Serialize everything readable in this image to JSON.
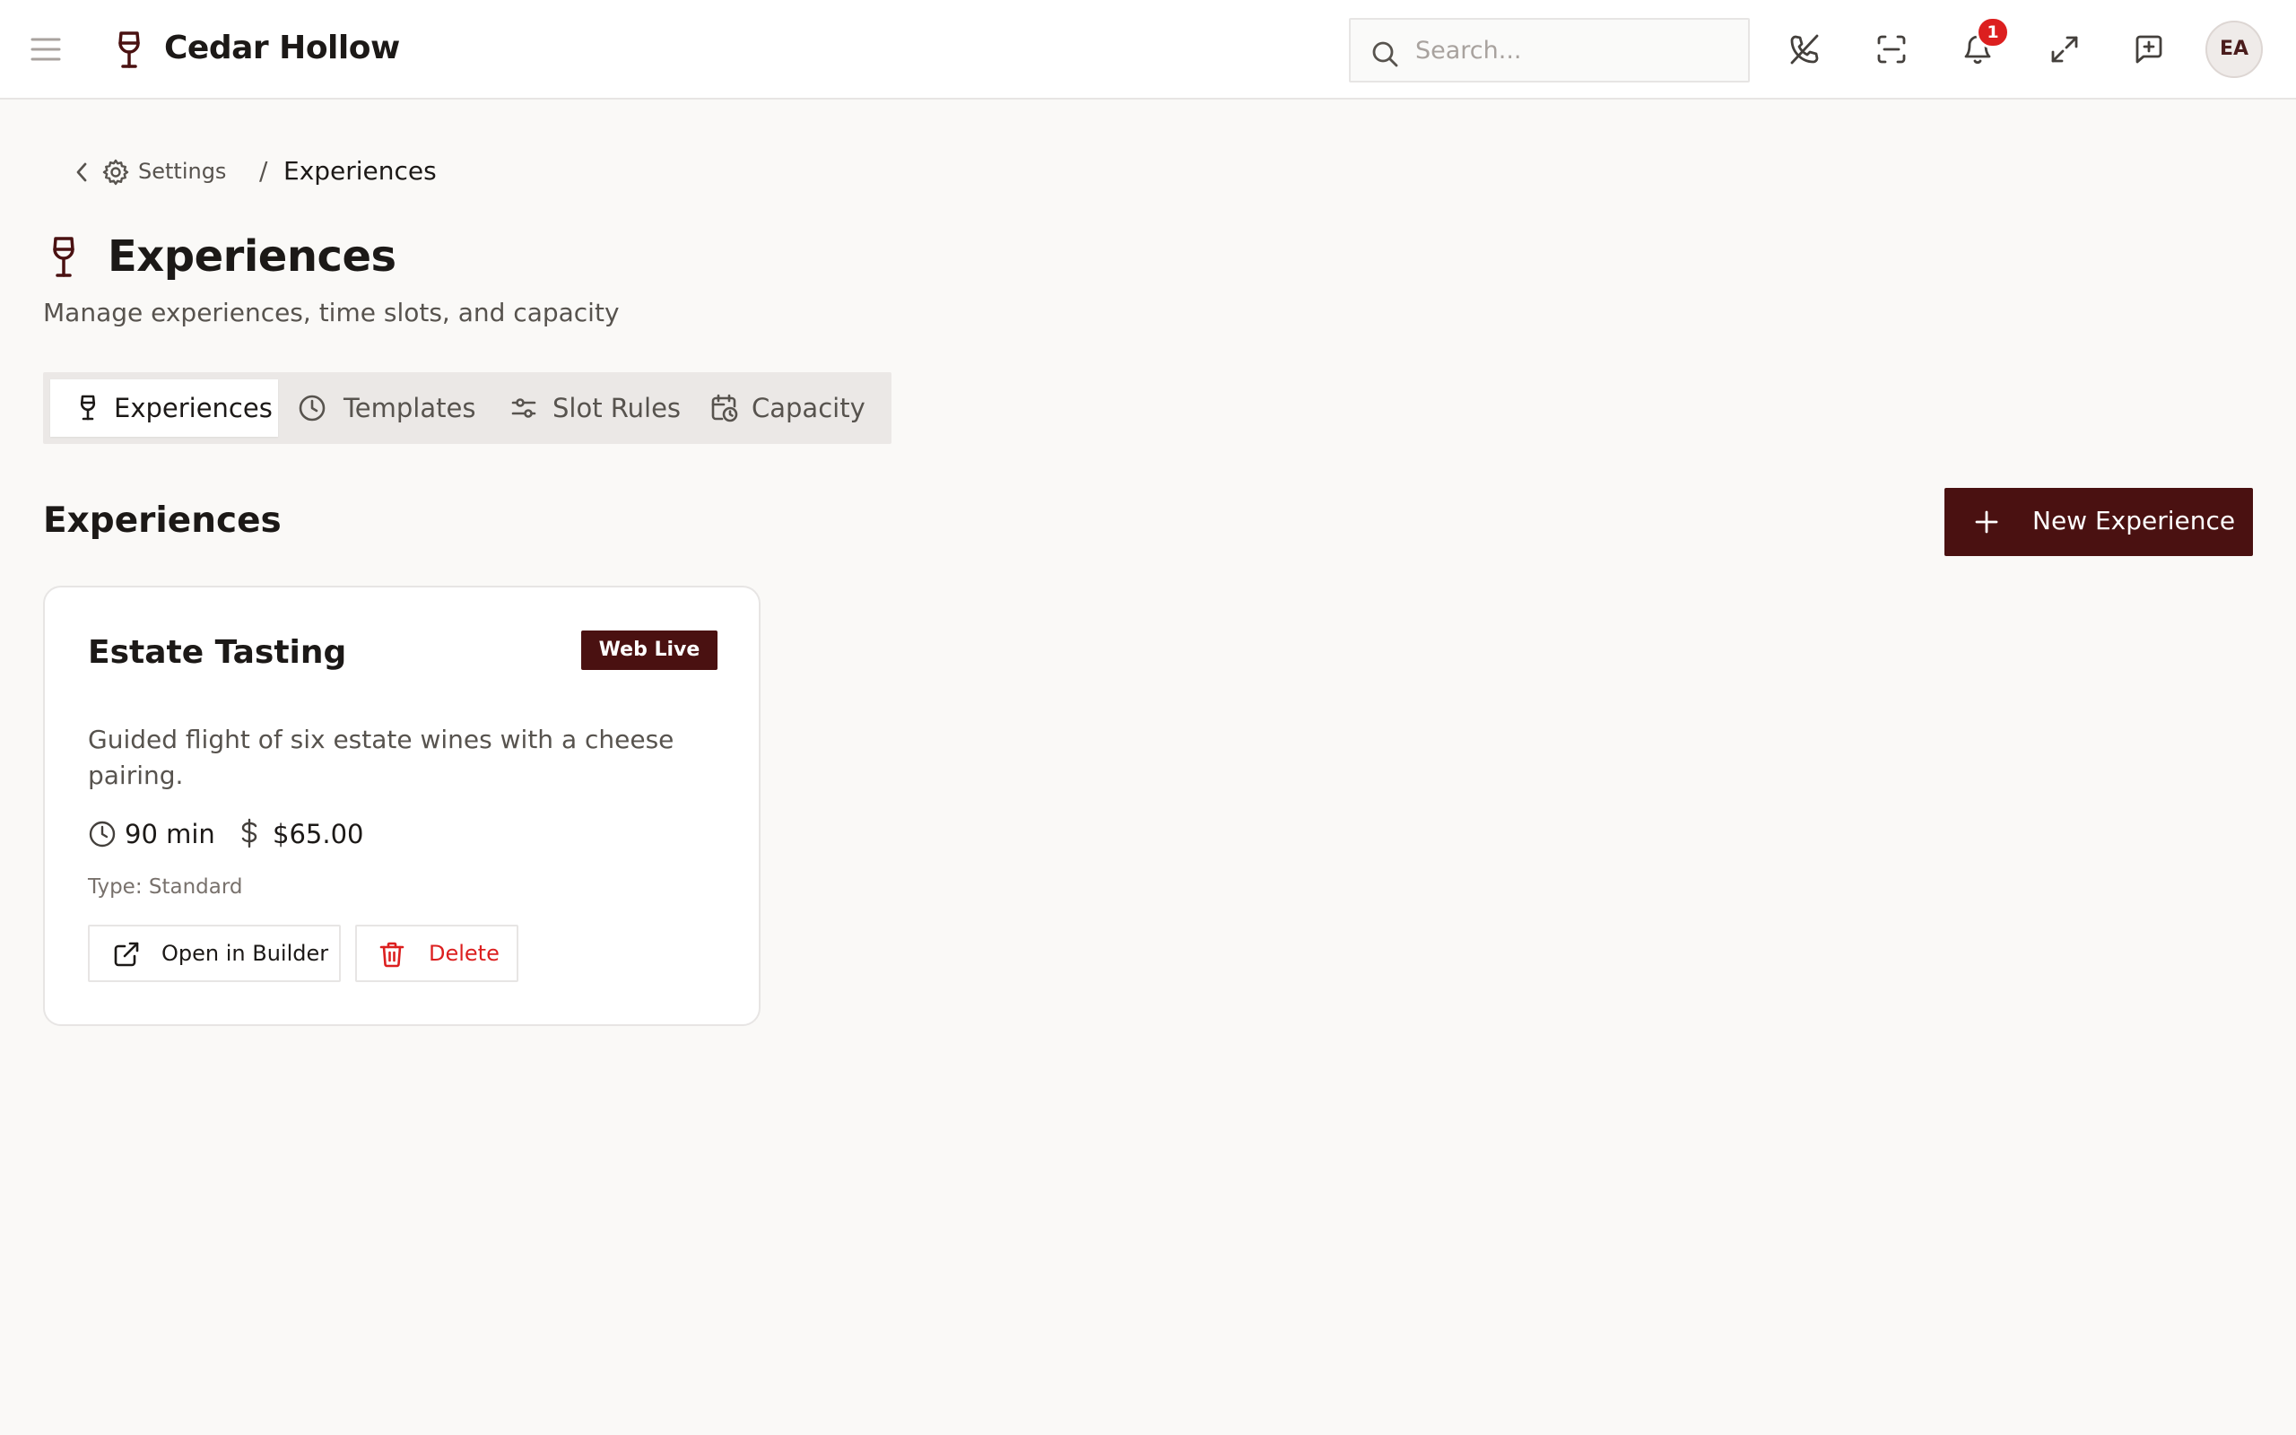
{
  "header": {
    "app_name": "Cedar Hollow",
    "search_placeholder": "Search...",
    "notification_count": "1",
    "avatar_initials": "EA"
  },
  "breadcrumb": {
    "parent": "Settings",
    "separator": "/",
    "current": "Experiences"
  },
  "page": {
    "title": "Experiences",
    "subtitle": "Manage experiences, time slots, and capacity"
  },
  "tabs": [
    {
      "label": "Experiences",
      "icon": "wine-glass-icon",
      "active": true
    },
    {
      "label": "Templates",
      "icon": "clock-icon",
      "active": false
    },
    {
      "label": "Slot Rules",
      "icon": "sliders-icon",
      "active": false
    },
    {
      "label": "Capacity",
      "icon": "calendar-clock-icon",
      "active": false
    }
  ],
  "section": {
    "title": "Experiences",
    "new_button_label": "New Experience"
  },
  "experience_card": {
    "title": "Estate Tasting",
    "status_badge": "Web Live",
    "description": "Guided flight of six estate wines with a cheese pairing.",
    "duration": "90 min",
    "price": "$65.00",
    "type": "Type: Standard",
    "open_button_label": "Open in Builder",
    "delete_button_label": "Delete"
  },
  "colors": {
    "brand": "#4a1111",
    "page_background": "#faf9f7",
    "danger": "#dc1f1f",
    "notification_badge": "#dc1f1f"
  }
}
